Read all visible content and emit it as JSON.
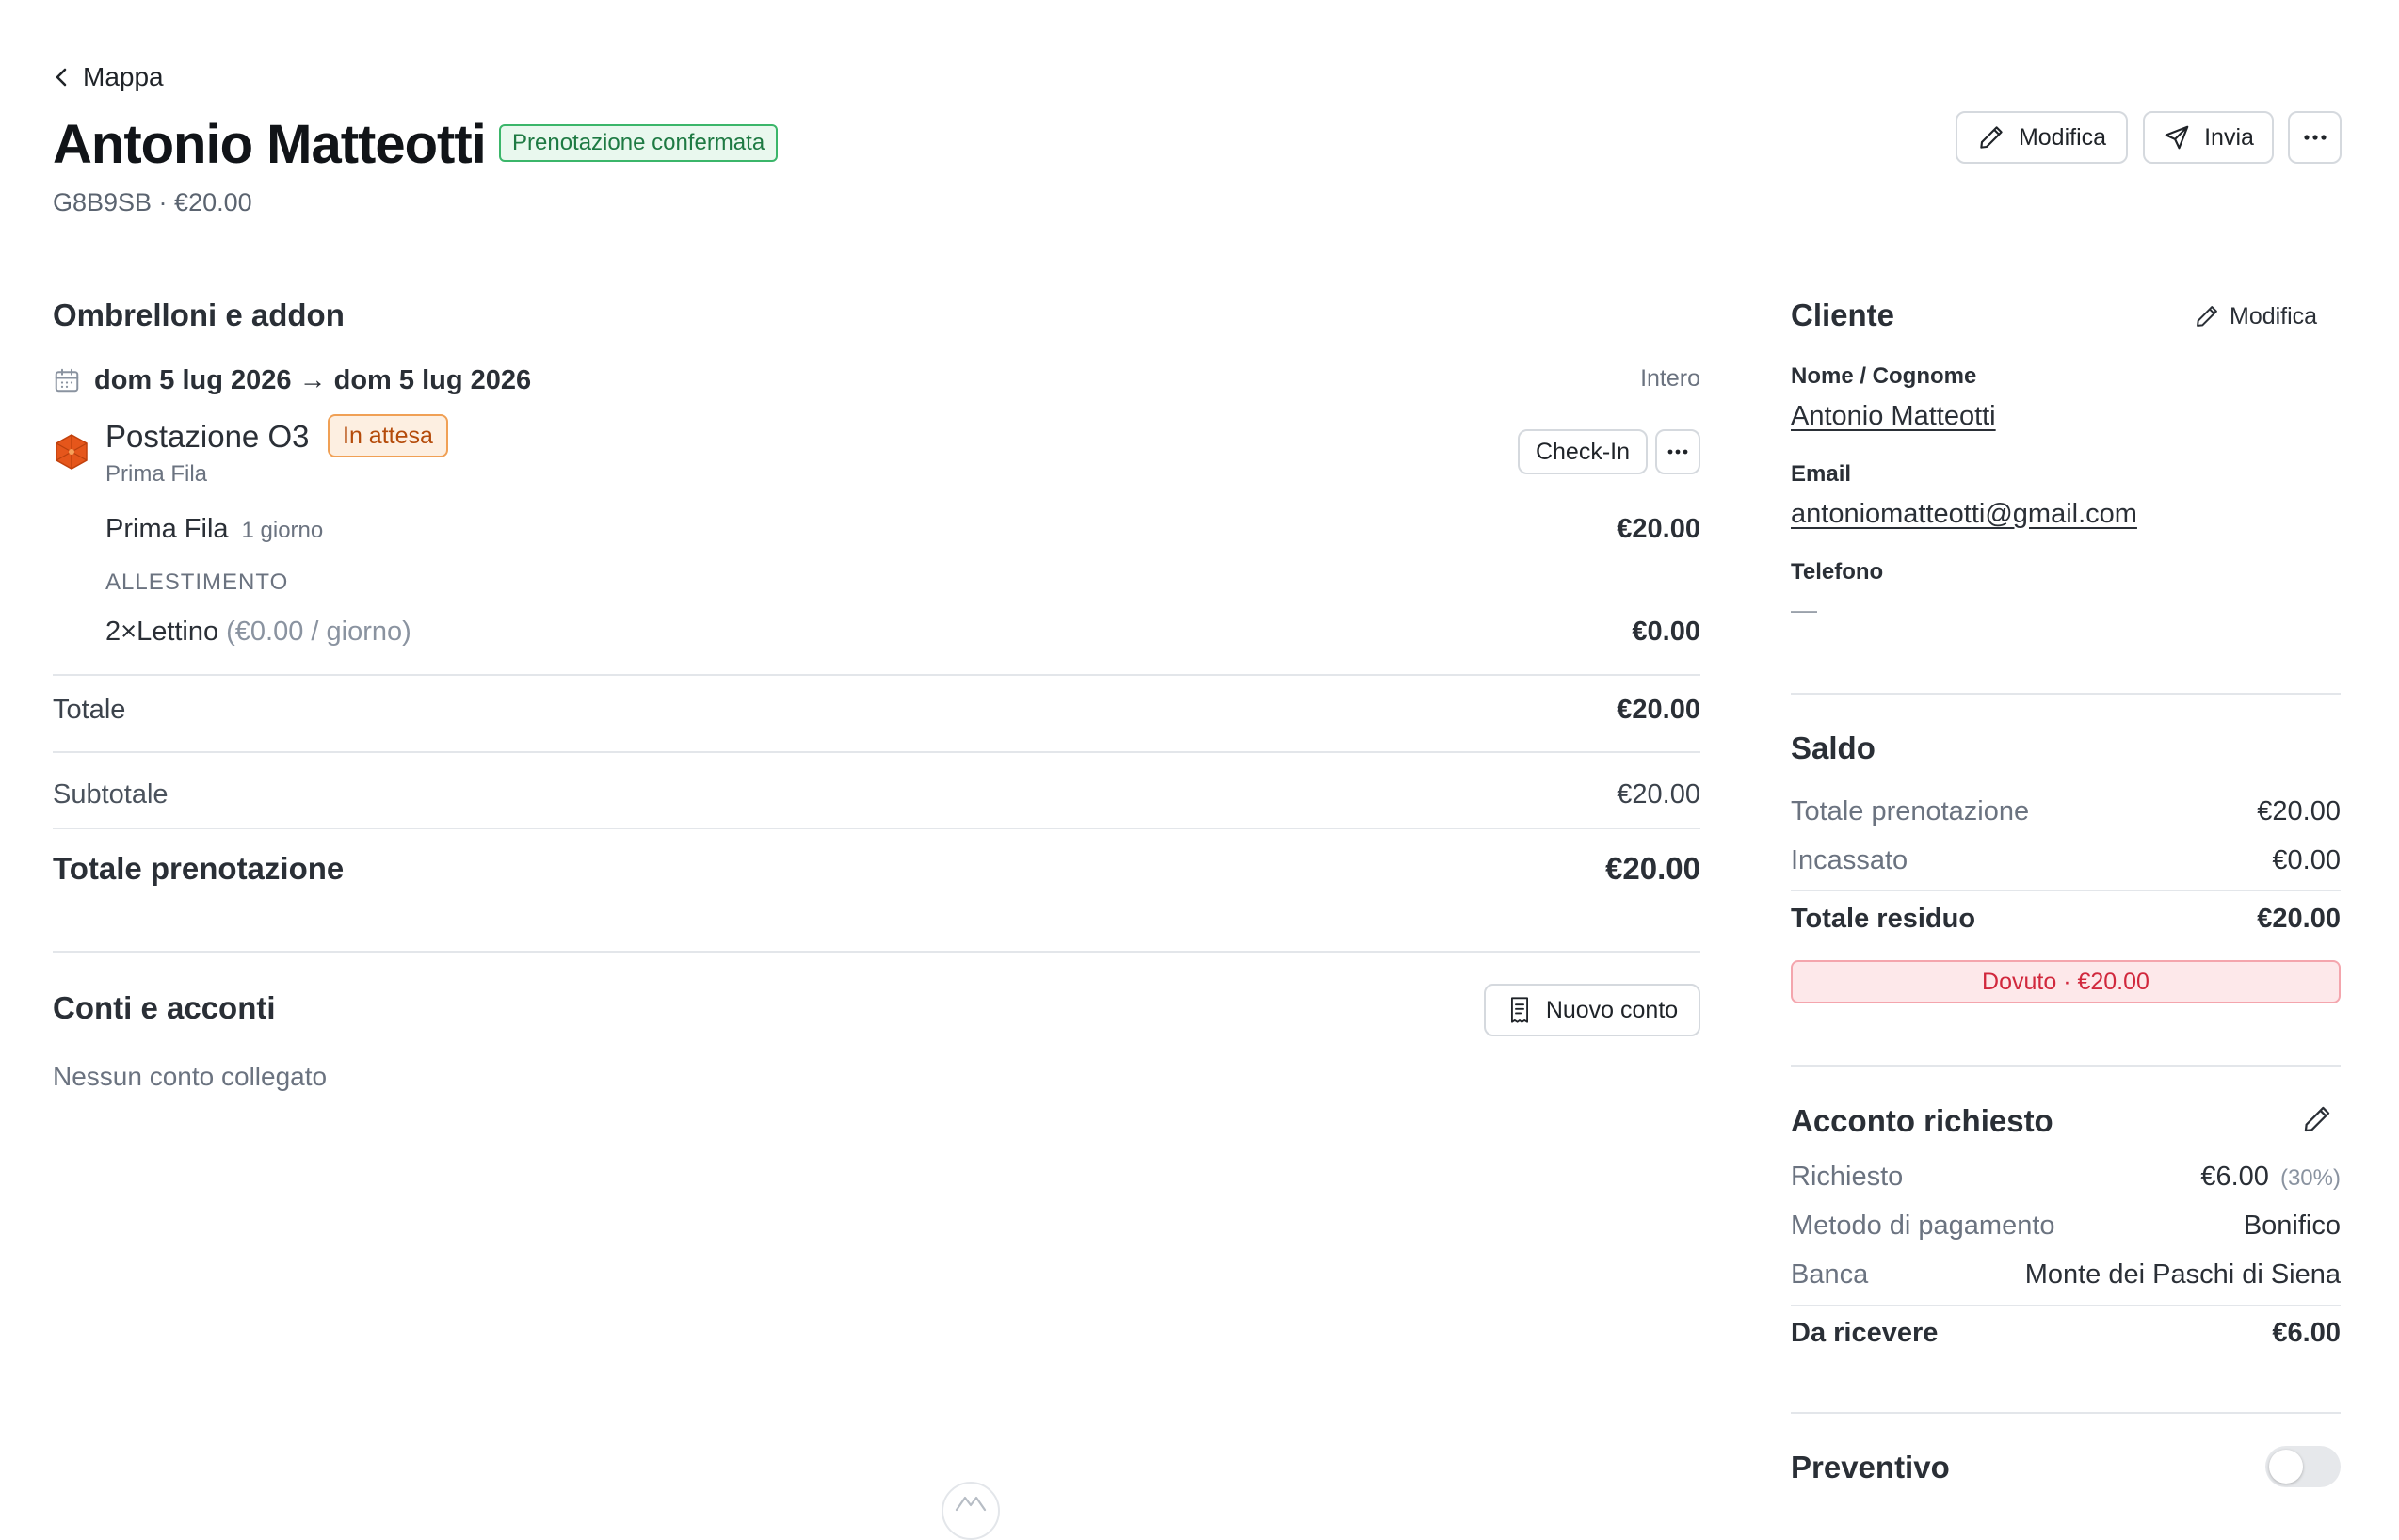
{
  "nav": {
    "back_label": "Mappa"
  },
  "header": {
    "title": "Antonio Matteotti",
    "status_badge": "Prenotazione confermata",
    "subline": "G8B9SB · €20.00",
    "edit_label": "Modifica",
    "send_label": "Invia"
  },
  "colors": {
    "success": "#3bb66a",
    "warning": "#f0a055",
    "danger": "#d1283d",
    "spot_icon": "#e5561b"
  },
  "icons": [
    "chevron-left-icon",
    "pencil-icon",
    "send-icon",
    "more-icon",
    "calendar-icon",
    "umbrella-icon",
    "receipt-icon",
    "toggle-switch"
  ],
  "booking": {
    "section_title": "Ombrelloni e addon",
    "date_range": "dom 5 lug 2026 → dom 5 lug 2026",
    "duration_type": "Intero",
    "spot": {
      "name": "Postazione O3",
      "status": "In attesa",
      "row": "Prima Fila",
      "checkin_label": "Check-In"
    },
    "item": {
      "name": "Prima Fila",
      "duration": "1 giorno",
      "amount": "€20.00"
    },
    "setup_label": "ALLESTIMENTO",
    "addon": {
      "name": "2×Lettino",
      "rate": "(€0.00 / giorno)",
      "amount": "€0.00"
    },
    "totale_label": "Totale",
    "totale_value": "€20.00",
    "subtotale_label": "Subtotale",
    "subtotale_value": "€20.00",
    "totale_prenotazione_label": "Totale prenotazione",
    "totale_prenotazione_value": "€20.00"
  },
  "accounts": {
    "title": "Conti e acconti",
    "new_button": "Nuovo conto",
    "empty_text": "Nessun conto collegato"
  },
  "customer": {
    "title": "Cliente",
    "edit_label": "Modifica",
    "name_label": "Nome / Cognome",
    "name_value": "Antonio Matteotti",
    "email_label": "Email",
    "email_value": "antoniomatteotti@gmail.com",
    "phone_label": "Telefono",
    "phone_value": "—"
  },
  "balance": {
    "title": "Saldo",
    "rows": [
      {
        "label": "Totale prenotazione",
        "value": "€20.00"
      },
      {
        "label": "Incassato",
        "value": "€0.00"
      }
    ],
    "residuo_label": "Totale residuo",
    "residuo_value": "€20.00",
    "due_badge": "Dovuto · €20.00"
  },
  "deposit": {
    "title": "Acconto richiesto",
    "requested_label": "Richiesto",
    "requested_value": "€6.00",
    "requested_pct": "(30%)",
    "method_label": "Metodo di pagamento",
    "method_value": "Bonifico",
    "bank_label": "Banca",
    "bank_value": "Monte dei Paschi di Siena",
    "to_receive_label": "Da ricevere",
    "to_receive_value": "€6.00"
  },
  "quote": {
    "title": "Preventivo",
    "enabled": false
  }
}
